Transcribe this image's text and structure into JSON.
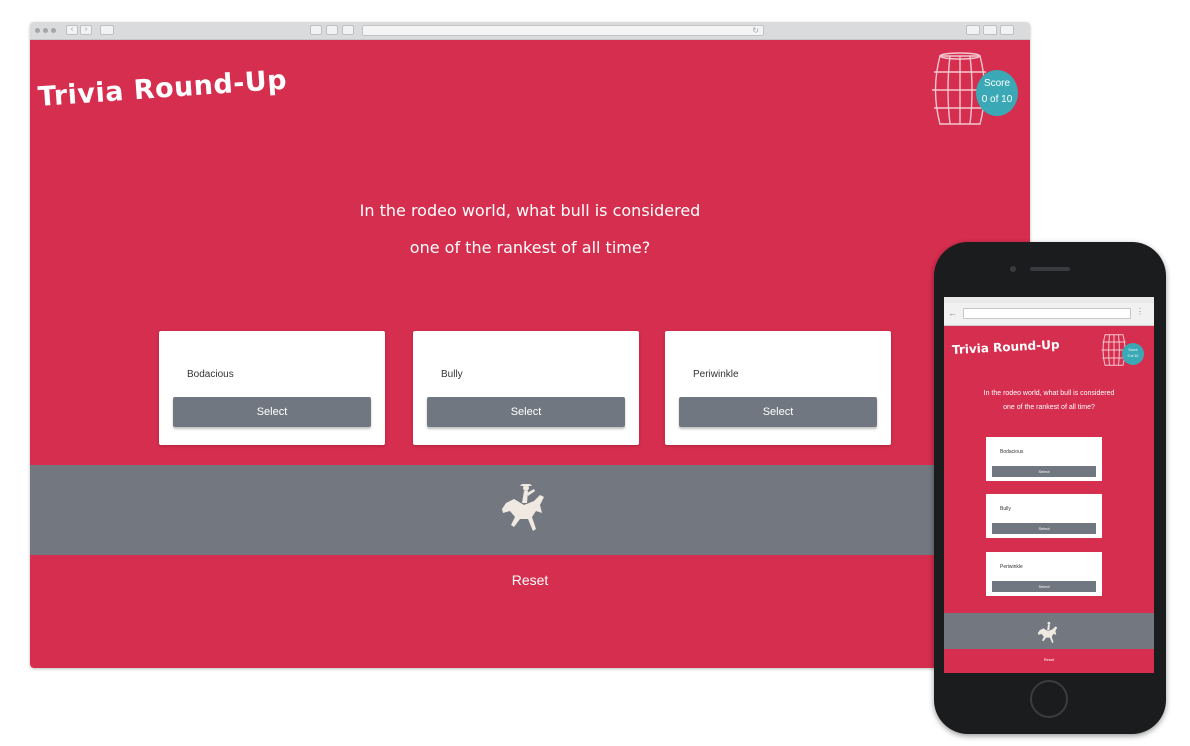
{
  "app": {
    "title": "Trivia Round-Up",
    "score_label": "Score",
    "score_value": "0 of 10",
    "question_line1": "In the rodeo world, what bull is considered",
    "question_line2": "one of the rankest of all time?",
    "answers": [
      {
        "label": "Bodacious",
        "button": "Select"
      },
      {
        "label": "Bully",
        "button": "Select"
      },
      {
        "label": "Periwinkle",
        "button": "Select"
      }
    ],
    "reset_label": "Reset"
  },
  "icons": {
    "barrel": "barrel-icon",
    "rider": "bronc-rider-icon",
    "back": "arrow-left-icon",
    "menu": "more-vertical-icon"
  },
  "colors": {
    "background": "#d62e4e",
    "band": "#737880",
    "button": "#707780",
    "score_badge": "#3aa9b5",
    "card": "#ffffff"
  }
}
